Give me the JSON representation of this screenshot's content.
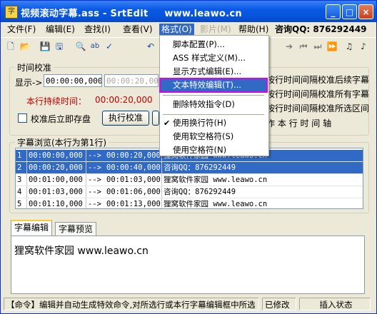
{
  "window": {
    "title": "视频滚动字幕.ass - SrtEdit",
    "title_url": "www.leawo.cn",
    "colors": {
      "titlebar": "#0a5ae6",
      "highlight": "#316ac5",
      "annotation_box": "#e400e4",
      "red_text": "#c00000"
    }
  },
  "title_buttons": {
    "minimize": "_",
    "maximize": "□",
    "close": "×"
  },
  "menubar": {
    "items": [
      {
        "label": "文件(F)"
      },
      {
        "label": "编辑(E)"
      },
      {
        "label": "查找(I)"
      },
      {
        "label": "查看(V)"
      },
      {
        "label": "格式(O)"
      },
      {
        "label": "影片(M)"
      },
      {
        "label": "帮助(H)"
      }
    ],
    "qq": "咨询QQ: 876292449"
  },
  "toolbar": {
    "icons": [
      "new-icon",
      "open-icon",
      "save-icon",
      "save-as-icon",
      "find-icon",
      "replace-icon",
      "spell-icon",
      "undo-icon",
      "arrow-right-icon",
      "prev-icon",
      "next-icon",
      "end-icon",
      "music-note-icon",
      "music-note-alt-icon"
    ],
    "glyphs": [
      "🗋",
      "📂",
      "💾",
      "🖫",
      "🔍",
      "ab",
      "✓",
      "↶",
      "➔",
      "⏮",
      "⏭",
      "⏩",
      "♫",
      "♪"
    ]
  },
  "timing": {
    "group_label": "时间校准",
    "display_label": "显示->",
    "start_time": "00:00:00,000",
    "end_time": "00:00:20,000",
    "duration_label": "本行持续时间：",
    "duration_value": "00:00:20,000",
    "save_checkbox_label": "校准后立即存盘",
    "calibrate_button": "执行校准",
    "right_options": [
      "按行时间间隔校准后续字幕",
      "按行时间间隔校准所有字幕",
      "按行时间间隔校准所选区间"
    ],
    "right_footer": "作 本 行 时 间 轴"
  },
  "browse": {
    "group_label": "字幕浏览(本行为第1行)",
    "rows": [
      {
        "num": "1",
        "start": "00:00:00,000",
        "arrow": "-->",
        "end": "00:00:20,000",
        "text": "狸窝软件家园 www.leawo.cn",
        "selected": true
      },
      {
        "num": "2",
        "start": "00:00:20,000",
        "arrow": "-->",
        "end": "00:00:40,000",
        "text": "咨询QQ：876292449",
        "selected": true
      },
      {
        "num": "3",
        "start": "00:01:00,000",
        "arrow": "-->",
        "end": "00:01:03,000",
        "text": "狸窝软件家园 www.leawo.cn",
        "selected": false
      },
      {
        "num": "4",
        "start": "00:01:03,000",
        "arrow": "-->",
        "end": "00:01:06,000",
        "text": "咨询QQ：876292449",
        "selected": false
      },
      {
        "num": "5",
        "start": "00:01:10,000",
        "arrow": "-->",
        "end": "00:01:13,000",
        "text": "狸窝软件家园 www.leawo.cn",
        "selected": false
      }
    ]
  },
  "tabs": [
    {
      "label": "字幕编辑",
      "active": true
    },
    {
      "label": "字幕预览",
      "active": false
    }
  ],
  "editor": {
    "text": "狸窝软件家园 www.leawo.cn"
  },
  "status": {
    "command": "【命令】编辑并自动生成特效命令,对所选行或本行字幕编辑框中所选",
    "modified": "已修改",
    "mode": "插入状态"
  },
  "format_menu": {
    "items": [
      {
        "label": "脚本配置(P)...",
        "checked": false,
        "highlighted": false
      },
      {
        "label": "ASS 样式定义(M)...",
        "checked": false,
        "highlighted": false
      },
      {
        "label": "显示方式编辑(E)...",
        "checked": false,
        "highlighted": false
      },
      {
        "label": "文本特效编辑(T)...",
        "checked": false,
        "highlighted": true
      },
      {
        "separator": true
      },
      {
        "label": "删除特效指令(D)",
        "checked": false,
        "highlighted": false
      },
      {
        "separator": true
      },
      {
        "label": "使用换行符(H)",
        "checked": true,
        "highlighted": false
      },
      {
        "label": "使用软空格符(S)",
        "checked": false,
        "highlighted": false
      },
      {
        "label": "使用空格符(N)",
        "checked": false,
        "highlighted": false
      }
    ],
    "check_glyph": "✔"
  }
}
